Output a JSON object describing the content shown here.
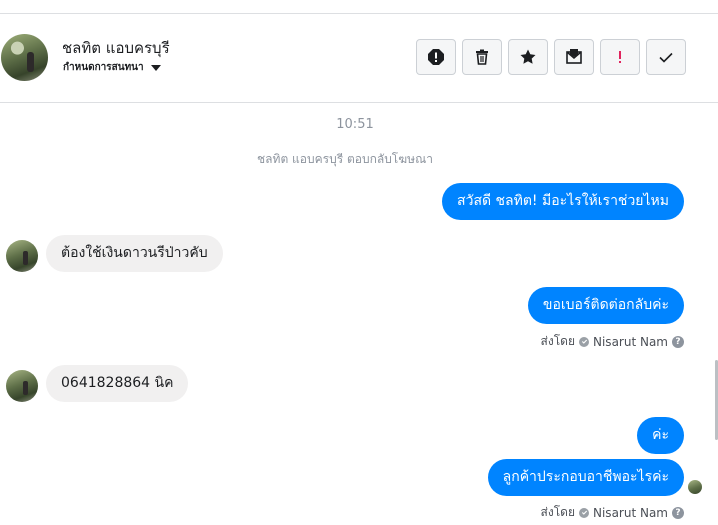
{
  "header": {
    "name": "ชลทิต แอบครบุรี",
    "subtitle": "กำหนดการสนทนา",
    "toolbar": [
      "spam-alert-icon",
      "trash-icon",
      "star-icon",
      "mark-unread-icon",
      "important-icon",
      "check-icon"
    ]
  },
  "conversation": {
    "timestamp": "10:51",
    "system_note": "ชลทิต แอบครบุรี ตอบกลับโฆษณา",
    "messages": [
      {
        "dir": "out",
        "text": "สวัสดี ชลทิต! มีอะไรให้เราช่วยไหม"
      },
      {
        "dir": "in",
        "text": "ต้องใช้เงินดาวนรีป่าวคับ"
      },
      {
        "dir": "out",
        "text": "ขอเบอร์ติดต่อกลับค่ะ"
      },
      {
        "dir": "in",
        "text": "0641828864 นิค"
      },
      {
        "dir": "out",
        "text": "ค่ะ"
      },
      {
        "dir": "out",
        "text": "ลูกค้าประกอบอาชีพอะไรค่ะ"
      }
    ],
    "sent_by_1": {
      "prefix": "ส่งโดย",
      "name": "Nisarut Nam",
      "help": "?"
    },
    "sent_by_2": {
      "prefix": "ส่งโดย",
      "name": "Nisarut Nam",
      "help": "?"
    }
  },
  "colors": {
    "outgoing": "#0084ff",
    "incoming": "#f1f0f0",
    "muted": "#8d949e"
  }
}
